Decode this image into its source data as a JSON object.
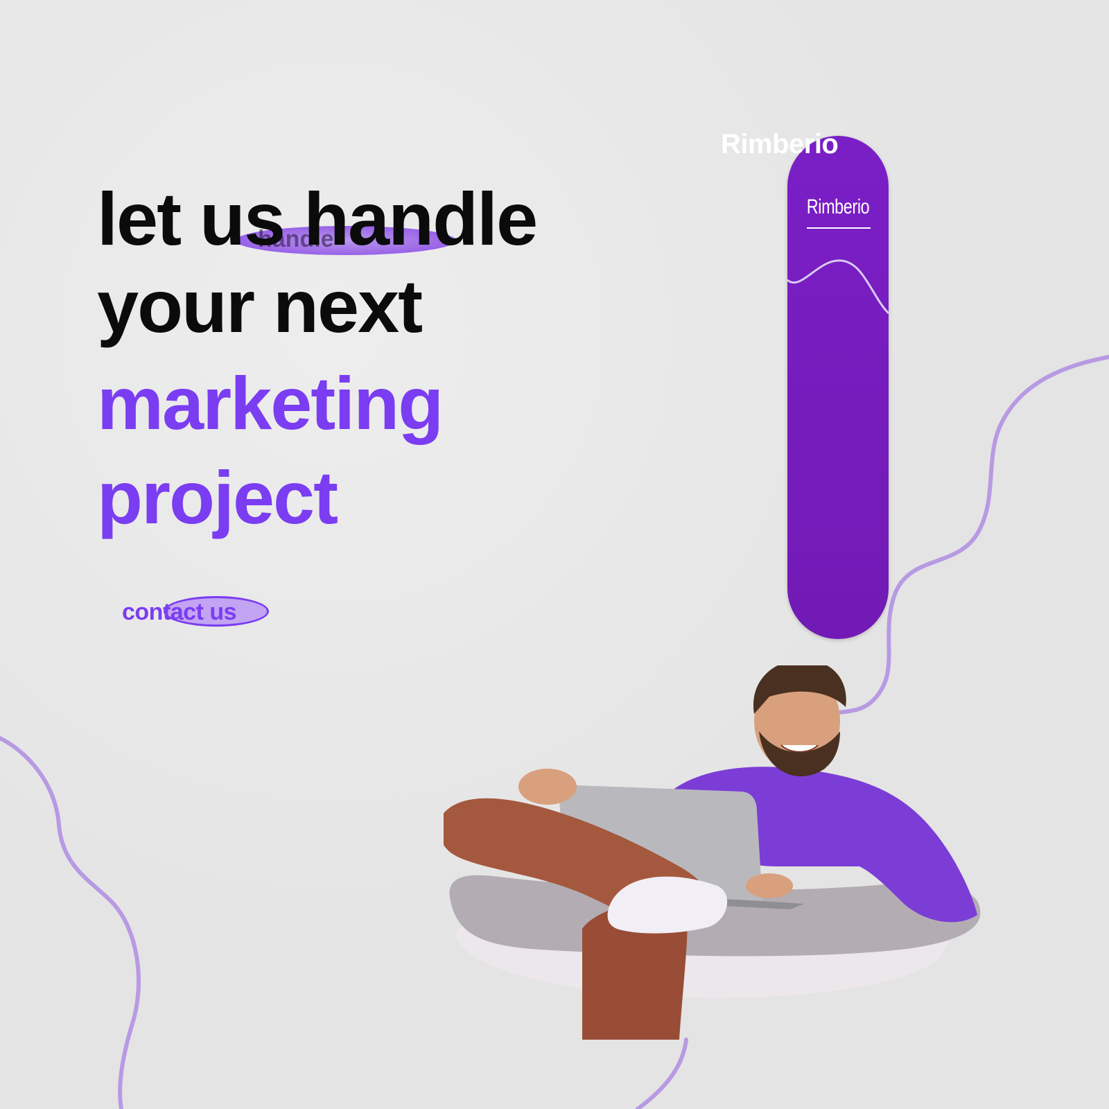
{
  "brand": {
    "name_top": "Rimberio",
    "name_bar": "Rimberio"
  },
  "headline": {
    "line1": "let us handle",
    "line2": "your next",
    "line3": "marketing",
    "line4": "project",
    "ghost_word": "handle"
  },
  "cta": {
    "label": "contact us"
  },
  "colors": {
    "accent": "#7b3df1",
    "bar": "#721ab5",
    "text": "#0b0b0b",
    "background": "#e4e4e4"
  },
  "illustration": {
    "subject": "man-with-laptop-in-chair"
  }
}
